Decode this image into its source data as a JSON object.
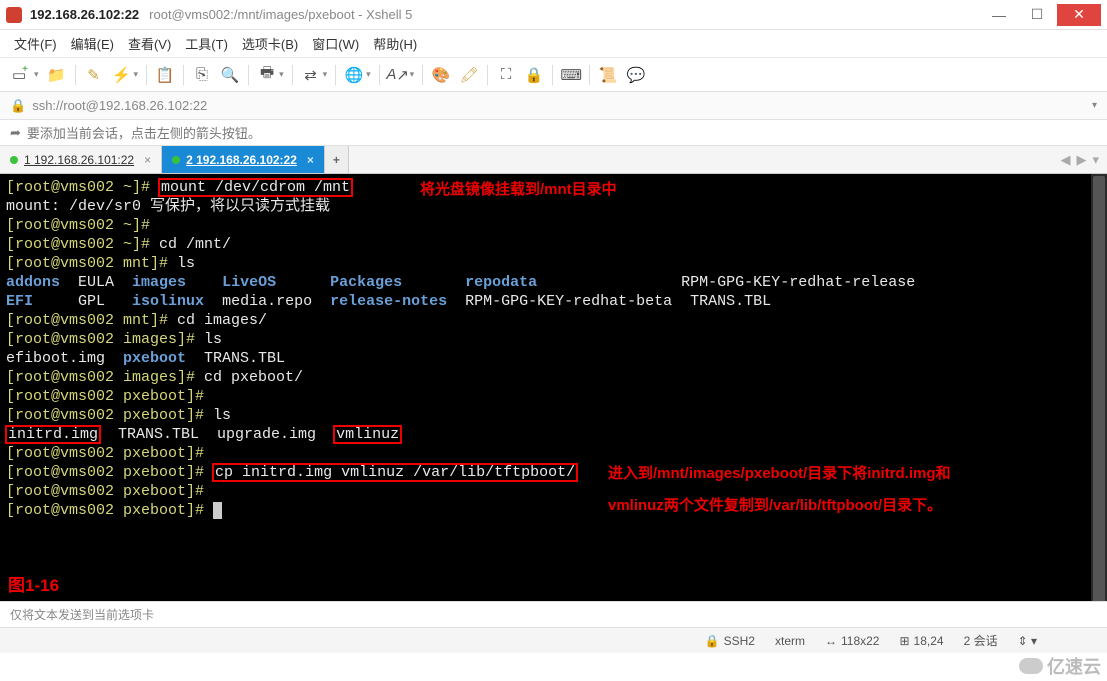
{
  "titlebar": {
    "ip": "192.168.26.102:22",
    "path": "root@vms002:/mnt/images/pxeboot - Xshell 5"
  },
  "menu": {
    "file": "文件(F)",
    "edit": "编辑(E)",
    "view": "查看(V)",
    "tools": "工具(T)",
    "tab": "选项卡(B)",
    "window": "窗口(W)",
    "help": "帮助(H)"
  },
  "addressbar": {
    "url": "ssh://root@192.168.26.102:22"
  },
  "hint": {
    "text": "要添加当前会话，点击左侧的箭头按钮。"
  },
  "tabs": {
    "tab1": "1 192.168.26.101:22",
    "tab2": "2 192.168.26.102:22"
  },
  "terminal": {
    "l1_prompt": "[root@vms002 ~]# ",
    "l1_cmd": "mount /dev/cdrom /mnt",
    "ann1": "将光盘镜像挂载到/mnt目录中",
    "l2": "mount: /dev/sr0 写保护，将以只读方式挂载",
    "l3": "[root@vms002 ~]# ",
    "l4": "[root@vms002 ~]# cd /mnt/",
    "l5_prompt": "[root@vms002 mnt]# ",
    "l5_cmd": "ls",
    "l6a": "addons",
    "l6b": "EULA",
    "l6c": "images",
    "l6d": "LiveOS",
    "l6e": "Packages",
    "l6f": "repodata",
    "l6g": "RPM-GPG-KEY-redhat-release",
    "l7a": "EFI",
    "l7b": "GPL",
    "l7c": "isolinux",
    "l7d": "media.repo",
    "l7e": "release-notes",
    "l7f": "RPM-GPG-KEY-redhat-beta",
    "l7g": "TRANS.TBL",
    "l8": "[root@vms002 mnt]# cd images/",
    "l9": "[root@vms002 images]# ls",
    "l10a": "efiboot.img  ",
    "l10b": "pxeboot",
    "l10c": "  TRANS.TBL",
    "l11": "[root@vms002 images]# cd pxeboot/",
    "l12": "[root@vms002 pxeboot]# ",
    "l13": "[root@vms002 pxeboot]# ls",
    "l14a": "initrd.img",
    "l14b": "  TRANS.TBL  upgrade.img  ",
    "l14c": "vmlinuz",
    "l15": "[root@vms002 pxeboot]# ",
    "l16_prompt": "[root@vms002 pxeboot]# ",
    "l16_cmd": "cp initrd.img vmlinuz /var/lib/tftpboot/",
    "ann2a": "进入到/mnt/images/pxeboot/目录下将initrd.img和",
    "ann2b": "vmlinuz两个文件复制到/var/lib/tftpboot/目录下。",
    "l17": "[root@vms002 pxeboot]# ",
    "l18": "[root@vms002 pxeboot]# ",
    "figlabel": "图1-16"
  },
  "bottominfo": {
    "text": "仅将文本发送到当前选项卡"
  },
  "statusbar": {
    "proto": "SSH2",
    "term": "xterm",
    "size": "118x22",
    "pos": "18,24",
    "sessions": "2 会话"
  },
  "watermark": {
    "text": "亿速云"
  }
}
